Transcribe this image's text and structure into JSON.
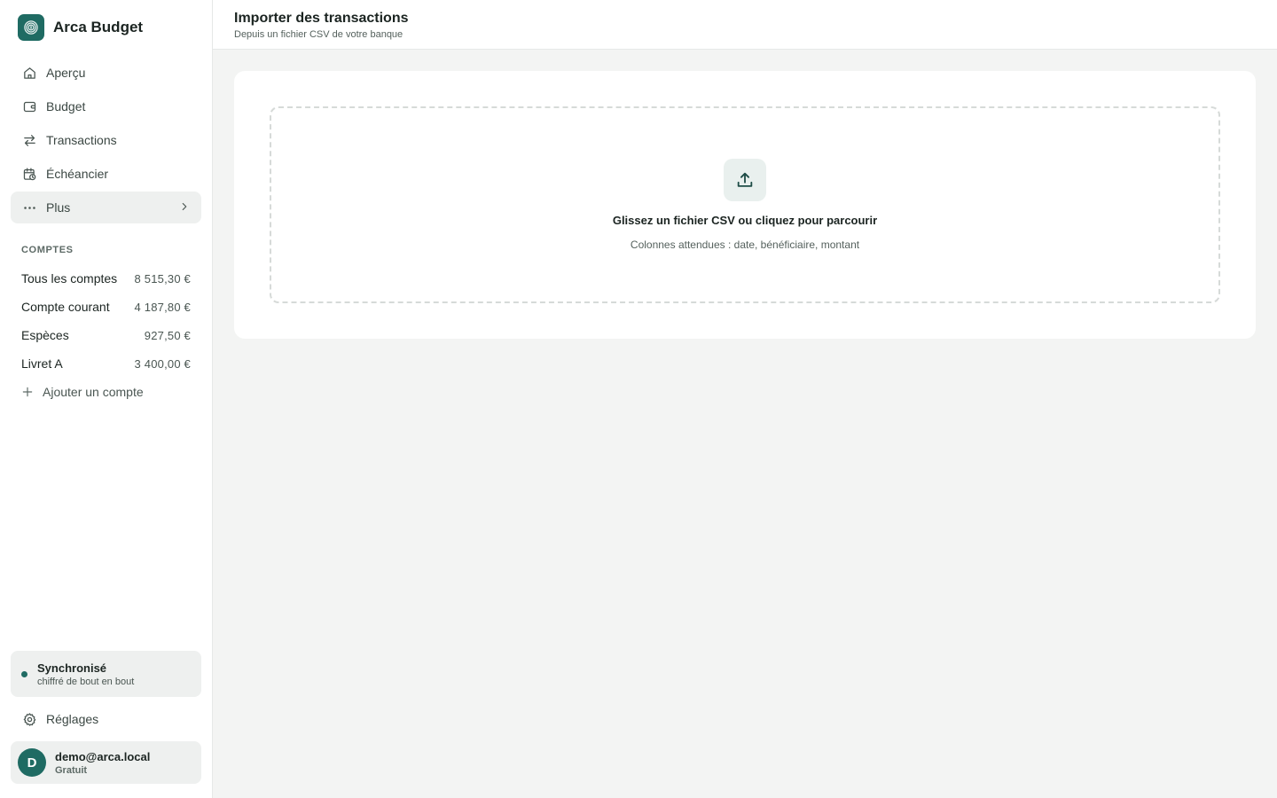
{
  "brand": {
    "name": "Arca Budget",
    "icon": "fingerprint-icon"
  },
  "nav": {
    "items": [
      {
        "label": "Aperçu",
        "icon": "home-icon"
      },
      {
        "label": "Budget",
        "icon": "wallet-icon"
      },
      {
        "label": "Transactions",
        "icon": "arrows-exchange-icon"
      },
      {
        "label": "Échéancier",
        "icon": "calendar-clock-icon"
      },
      {
        "label": "Plus",
        "icon": "more-dots-icon",
        "active": true
      }
    ]
  },
  "accounts": {
    "title": "COMPTES",
    "items": [
      {
        "name": "Tous les comptes",
        "amount": "8 515,30 €"
      },
      {
        "name": "Compte courant",
        "amount": "4 187,80 €"
      },
      {
        "name": "Espèces",
        "amount": "927,50 €"
      },
      {
        "name": "Livret A",
        "amount": "3 400,00 €"
      }
    ],
    "add_label": "Ajouter un compte"
  },
  "sync": {
    "title": "Synchronisé",
    "subtitle": "chiffré de bout en bout"
  },
  "settings": {
    "label": "Réglages",
    "icon": "gear-icon"
  },
  "user": {
    "initial": "D",
    "email": "demo@arca.local",
    "plan": "Gratuit"
  },
  "header": {
    "title": "Importer des transactions",
    "subtitle": "Depuis un fichier CSV de votre banque"
  },
  "dropzone": {
    "title": "Glissez un fichier CSV ou cliquez pour parcourir",
    "subtitle": "Colonnes attendues : date, bénéficiaire, montant",
    "icon": "upload-icon"
  },
  "colors": {
    "accent": "#1f6b63",
    "background": "#f3f4f3",
    "surface": "#ffffff"
  }
}
